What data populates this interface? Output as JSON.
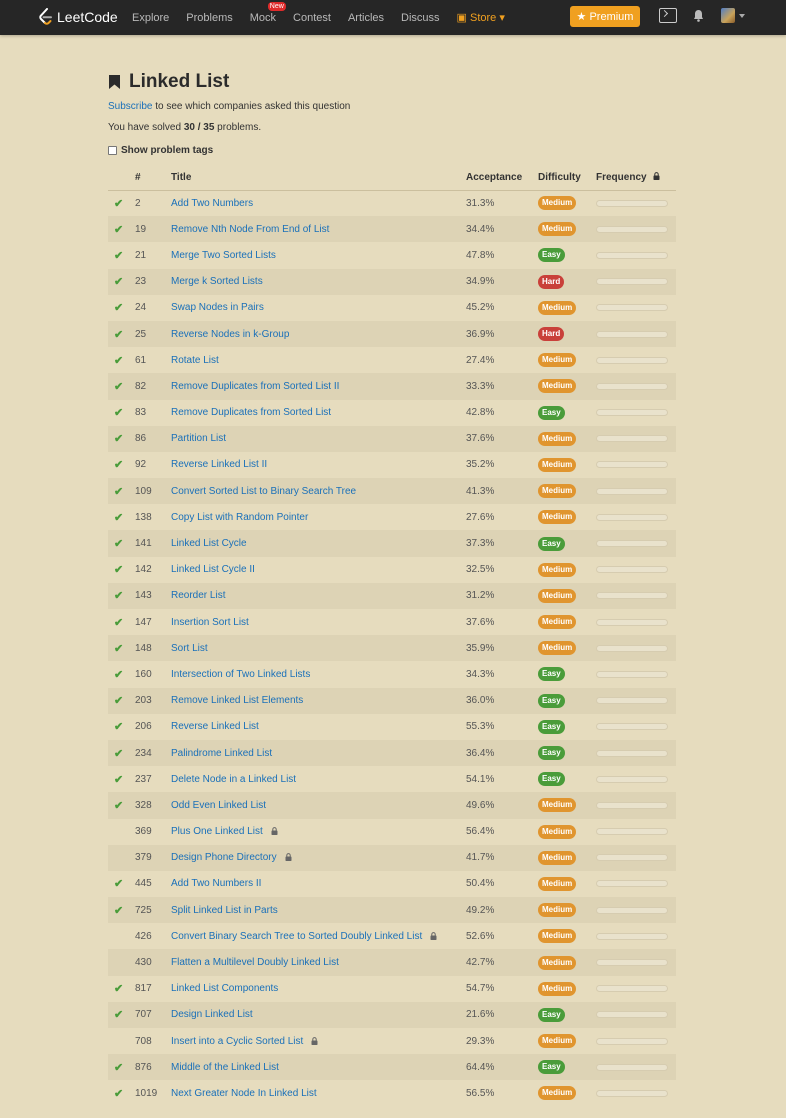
{
  "nav": {
    "logo": "LeetCode",
    "links": [
      "Explore",
      "Problems",
      "Mock",
      "Contest",
      "Articles",
      "Discuss"
    ],
    "new_badge": "New",
    "store": "Store",
    "premium": "Premium"
  },
  "page": {
    "title": "Linked List",
    "subscribe_link": "Subscribe",
    "subscribe_rest": " to see which companies asked this question",
    "solved_prefix": "You have solved ",
    "solved_count": "30 / 35",
    "solved_suffix": " problems.",
    "show_tags": "Show problem tags"
  },
  "table": {
    "headers": [
      "#",
      "Title",
      "Acceptance",
      "Difficulty",
      "Frequency"
    ],
    "rows": [
      {
        "solved": true,
        "num": "2",
        "title": "Add Two Numbers",
        "locked": false,
        "acceptance": "31.3%",
        "difficulty": "Medium"
      },
      {
        "solved": true,
        "num": "19",
        "title": "Remove Nth Node From End of List",
        "locked": false,
        "acceptance": "34.4%",
        "difficulty": "Medium"
      },
      {
        "solved": true,
        "num": "21",
        "title": "Merge Two Sorted Lists",
        "locked": false,
        "acceptance": "47.8%",
        "difficulty": "Easy"
      },
      {
        "solved": true,
        "num": "23",
        "title": "Merge k Sorted Lists",
        "locked": false,
        "acceptance": "34.9%",
        "difficulty": "Hard"
      },
      {
        "solved": true,
        "num": "24",
        "title": "Swap Nodes in Pairs",
        "locked": false,
        "acceptance": "45.2%",
        "difficulty": "Medium"
      },
      {
        "solved": true,
        "num": "25",
        "title": "Reverse Nodes in k-Group",
        "locked": false,
        "acceptance": "36.9%",
        "difficulty": "Hard"
      },
      {
        "solved": true,
        "num": "61",
        "title": "Rotate List",
        "locked": false,
        "acceptance": "27.4%",
        "difficulty": "Medium"
      },
      {
        "solved": true,
        "num": "82",
        "title": "Remove Duplicates from Sorted List II",
        "locked": false,
        "acceptance": "33.3%",
        "difficulty": "Medium"
      },
      {
        "solved": true,
        "num": "83",
        "title": "Remove Duplicates from Sorted List",
        "locked": false,
        "acceptance": "42.8%",
        "difficulty": "Easy"
      },
      {
        "solved": true,
        "num": "86",
        "title": "Partition List",
        "locked": false,
        "acceptance": "37.6%",
        "difficulty": "Medium"
      },
      {
        "solved": true,
        "num": "92",
        "title": "Reverse Linked List II",
        "locked": false,
        "acceptance": "35.2%",
        "difficulty": "Medium"
      },
      {
        "solved": true,
        "num": "109",
        "title": "Convert Sorted List to Binary Search Tree",
        "locked": false,
        "acceptance": "41.3%",
        "difficulty": "Medium"
      },
      {
        "solved": true,
        "num": "138",
        "title": "Copy List with Random Pointer",
        "locked": false,
        "acceptance": "27.6%",
        "difficulty": "Medium"
      },
      {
        "solved": true,
        "num": "141",
        "title": "Linked List Cycle",
        "locked": false,
        "acceptance": "37.3%",
        "difficulty": "Easy"
      },
      {
        "solved": true,
        "num": "142",
        "title": "Linked List Cycle II",
        "locked": false,
        "acceptance": "32.5%",
        "difficulty": "Medium"
      },
      {
        "solved": true,
        "num": "143",
        "title": "Reorder List",
        "locked": false,
        "acceptance": "31.2%",
        "difficulty": "Medium"
      },
      {
        "solved": true,
        "num": "147",
        "title": "Insertion Sort List",
        "locked": false,
        "acceptance": "37.6%",
        "difficulty": "Medium"
      },
      {
        "solved": true,
        "num": "148",
        "title": "Sort List",
        "locked": false,
        "acceptance": "35.9%",
        "difficulty": "Medium"
      },
      {
        "solved": true,
        "num": "160",
        "title": "Intersection of Two Linked Lists",
        "locked": false,
        "acceptance": "34.3%",
        "difficulty": "Easy"
      },
      {
        "solved": true,
        "num": "203",
        "title": "Remove Linked List Elements",
        "locked": false,
        "acceptance": "36.0%",
        "difficulty": "Easy"
      },
      {
        "solved": true,
        "num": "206",
        "title": "Reverse Linked List",
        "locked": false,
        "acceptance": "55.3%",
        "difficulty": "Easy"
      },
      {
        "solved": true,
        "num": "234",
        "title": "Palindrome Linked List",
        "locked": false,
        "acceptance": "36.4%",
        "difficulty": "Easy"
      },
      {
        "solved": true,
        "num": "237",
        "title": "Delete Node in a Linked List",
        "locked": false,
        "acceptance": "54.1%",
        "difficulty": "Easy"
      },
      {
        "solved": true,
        "num": "328",
        "title": "Odd Even Linked List",
        "locked": false,
        "acceptance": "49.6%",
        "difficulty": "Medium"
      },
      {
        "solved": false,
        "num": "369",
        "title": "Plus One Linked List",
        "locked": true,
        "acceptance": "56.4%",
        "difficulty": "Medium"
      },
      {
        "solved": false,
        "num": "379",
        "title": "Design Phone Directory",
        "locked": true,
        "acceptance": "41.7%",
        "difficulty": "Medium"
      },
      {
        "solved": true,
        "num": "445",
        "title": "Add Two Numbers II",
        "locked": false,
        "acceptance": "50.4%",
        "difficulty": "Medium"
      },
      {
        "solved": true,
        "num": "725",
        "title": "Split Linked List in Parts",
        "locked": false,
        "acceptance": "49.2%",
        "difficulty": "Medium"
      },
      {
        "solved": false,
        "num": "426",
        "title": "Convert Binary Search Tree to Sorted Doubly Linked List",
        "locked": true,
        "acceptance": "52.6%",
        "difficulty": "Medium"
      },
      {
        "solved": false,
        "num": "430",
        "title": "Flatten a Multilevel Doubly Linked List",
        "locked": false,
        "acceptance": "42.7%",
        "difficulty": "Medium"
      },
      {
        "solved": true,
        "num": "817",
        "title": "Linked List Components",
        "locked": false,
        "acceptance": "54.7%",
        "difficulty": "Medium"
      },
      {
        "solved": true,
        "num": "707",
        "title": "Design Linked List",
        "locked": false,
        "acceptance": "21.6%",
        "difficulty": "Easy"
      },
      {
        "solved": false,
        "num": "708",
        "title": "Insert into a Cyclic Sorted List",
        "locked": true,
        "acceptance": "29.3%",
        "difficulty": "Medium"
      },
      {
        "solved": true,
        "num": "876",
        "title": "Middle of the Linked List",
        "locked": false,
        "acceptance": "64.4%",
        "difficulty": "Easy"
      },
      {
        "solved": true,
        "num": "1019",
        "title": "Next Greater Node In Linked List",
        "locked": false,
        "acceptance": "56.5%",
        "difficulty": "Medium"
      }
    ]
  },
  "colors": {
    "page_bg": "#e6dcbe",
    "navbar_bg": "#262626",
    "link": "#1a70b9",
    "premium": "#f0a020",
    "easy": "#4a9c3a",
    "medium": "#e0952f",
    "hard": "#c9403a"
  },
  "icons": {
    "logo": "leetcode-logo-icon",
    "bookmark": "bookmark-icon",
    "check": "checkmark-icon",
    "lock": "lock-icon",
    "terminal": "terminal-icon",
    "bell": "bell-icon",
    "star": "star-icon"
  }
}
